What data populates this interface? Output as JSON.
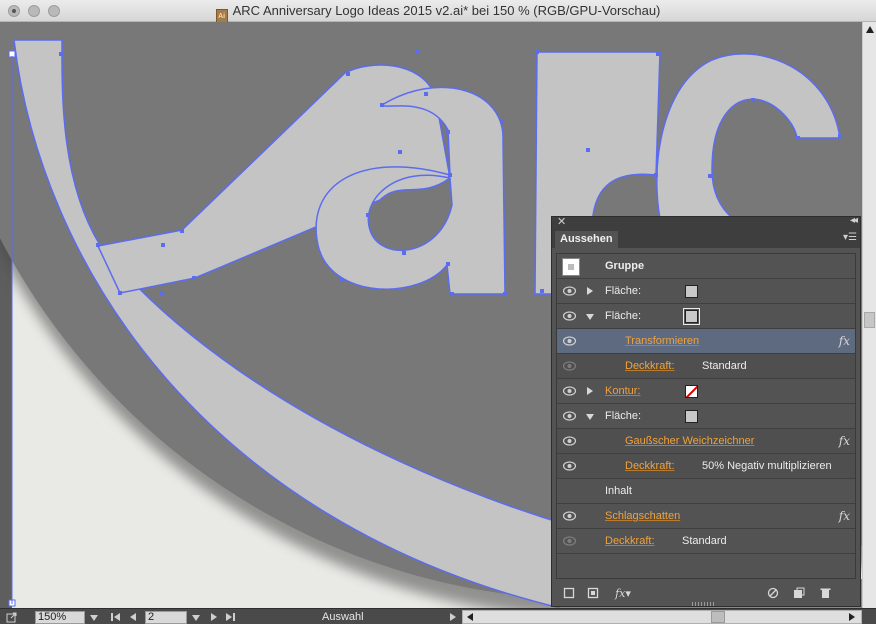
{
  "window": {
    "title": "ARC Anniversary Logo Ideas 2015 v2.ai* bei 150 % (RGB/GPU-Vorschau)",
    "doc_icon": "Ai"
  },
  "status_bar": {
    "zoom": "150%",
    "artboard": "2",
    "tool": "Auswahl"
  },
  "panel": {
    "tab": "Aussehen",
    "rows": [
      {
        "label": "Gruppe",
        "kind": "group"
      },
      {
        "label": "Fläche:",
        "kind": "fill",
        "twirl": "closed"
      },
      {
        "label": "Fläche:",
        "kind": "fill-selected",
        "twirl": "open"
      },
      {
        "label": "Transformieren",
        "kind": "effect",
        "selected": true
      },
      {
        "label": "Deckkraft:",
        "value": "Standard",
        "kind": "opacity-sub"
      },
      {
        "label": "Kontur:",
        "kind": "stroke",
        "twirl": "closed"
      },
      {
        "label": "Fläche:",
        "kind": "fill",
        "twirl": "open"
      },
      {
        "label": "Gaußscher Weichzeichner",
        "kind": "effect"
      },
      {
        "label": "Deckkraft:",
        "value": "50% Negativ multiplizieren",
        "kind": "opacity-sub"
      },
      {
        "label": "Inhalt",
        "kind": "content"
      },
      {
        "label": "Schlagschatten",
        "kind": "effect-top"
      },
      {
        "label": "Deckkraft:",
        "value": "Standard",
        "kind": "opacity-top"
      }
    ],
    "fx_label": "fx",
    "bottom_fx": "fx"
  },
  "colors": {
    "canvas_bg": "#5e5e5e",
    "artboard": "#e9e9e5",
    "circle": "#787878",
    "letter_fill": "#c4c4c4",
    "path_highlight": "#5b6cf0",
    "panel_bg": "#535353",
    "selected_row": "#5d6a80",
    "link_orange": "#f0a23c"
  }
}
